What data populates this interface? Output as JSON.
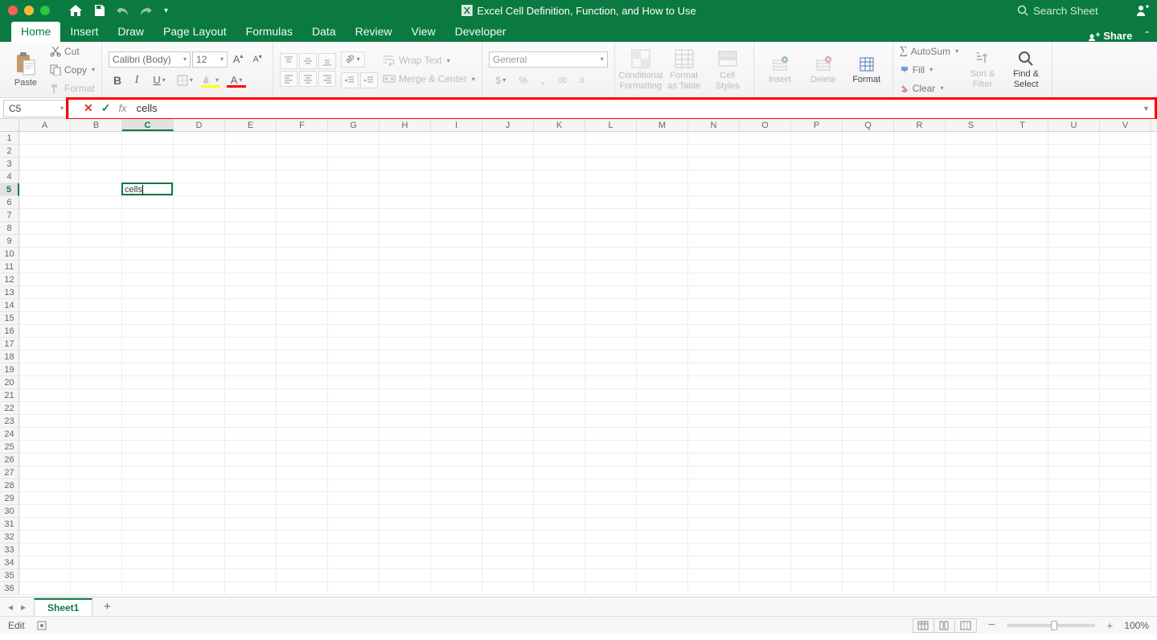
{
  "title": "Excel Cell Definition, Function, and How to Use",
  "search_placeholder": "Search Sheet",
  "tabs": [
    "Home",
    "Insert",
    "Draw",
    "Page Layout",
    "Formulas",
    "Data",
    "Review",
    "View",
    "Developer"
  ],
  "active_tab": "Home",
  "share_label": "Share",
  "clipboard": {
    "paste": "Paste",
    "cut": "Cut",
    "copy": "Copy",
    "format": "Format"
  },
  "font": {
    "name": "Calibri (Body)",
    "size": "12"
  },
  "alignment": {
    "wrap": "Wrap Text",
    "merge": "Merge & Center"
  },
  "number_format": "General",
  "cells_group": {
    "conditional": "Conditional Formatting",
    "format_table": "Format as Table",
    "cell_styles": "Cell Styles",
    "insert": "Insert",
    "delete": "Delete",
    "format": "Format"
  },
  "editing": {
    "autosum": "AutoSum",
    "fill": "Fill",
    "clear": "Clear",
    "sort": "Sort & Filter",
    "find": "Find & Select"
  },
  "name_box": "C5",
  "formula_value": "cells",
  "columns": [
    "A",
    "B",
    "C",
    "D",
    "E",
    "F",
    "G",
    "H",
    "I",
    "J",
    "K",
    "L",
    "M",
    "N",
    "O",
    "P",
    "Q",
    "R",
    "S",
    "T",
    "U",
    "V"
  ],
  "row_count": 36,
  "active": {
    "col": "C",
    "row": 5,
    "value": "cells"
  },
  "sheet_name": "Sheet1",
  "status_mode": "Edit",
  "zoom": "100%"
}
